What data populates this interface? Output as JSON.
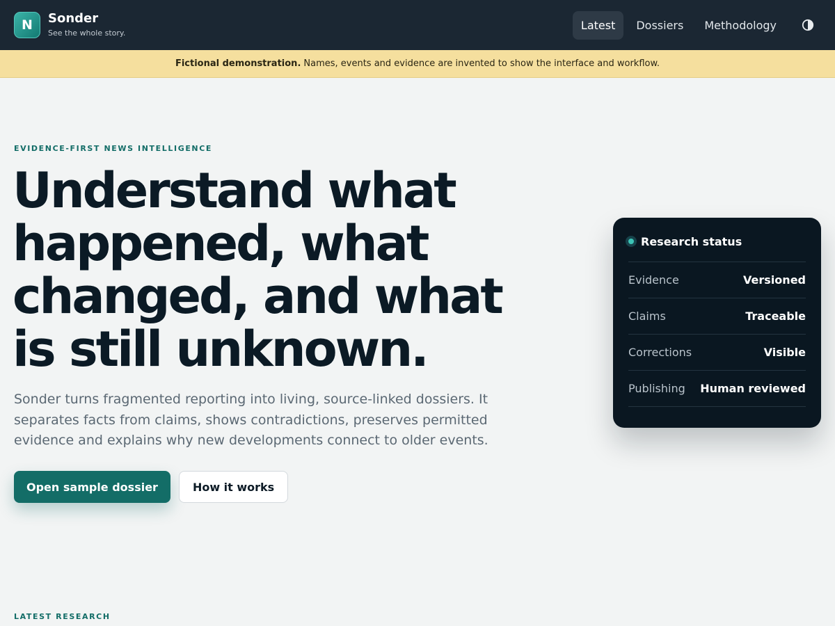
{
  "header": {
    "logo_letter": "N",
    "brand_name": "Sonder",
    "tagline": "See the whole story.",
    "nav": [
      {
        "label": "Latest",
        "active": true
      },
      {
        "label": "Dossiers",
        "active": false
      },
      {
        "label": "Methodology",
        "active": false
      }
    ],
    "theme_icon": "contrast-icon"
  },
  "banner": {
    "strong": "Fictional demonstration.",
    "text": "Names, events and evidence are invented to show the interface and workflow."
  },
  "hero": {
    "eyebrow": "EVIDENCE-FIRST NEWS INTELLIGENCE",
    "title": "Understand what happened, what changed, and what is still unknown.",
    "subtitle": "Sonder turns fragmented reporting into living, source-linked dossiers. It separates facts from claims, shows contradictions, preserves permitted evidence and explains why new developments connect to older events.",
    "primary_cta": "Open sample dossier",
    "secondary_cta": "How it works"
  },
  "status_card": {
    "title": "Research status",
    "rows": [
      {
        "label": "Evidence",
        "value": "Versioned"
      },
      {
        "label": "Claims",
        "value": "Traceable"
      },
      {
        "label": "Corrections",
        "value": "Visible"
      },
      {
        "label": "Publishing",
        "value": "Human reviewed"
      }
    ]
  },
  "latest": {
    "eyebrow": "LATEST RESEARCH"
  },
  "colors": {
    "header_bg": "#1b2733",
    "accent": "#136d67",
    "banner_bg": "#f5df9e",
    "card_bg": "#0a1721",
    "status_dot": "#3cc4b6"
  }
}
